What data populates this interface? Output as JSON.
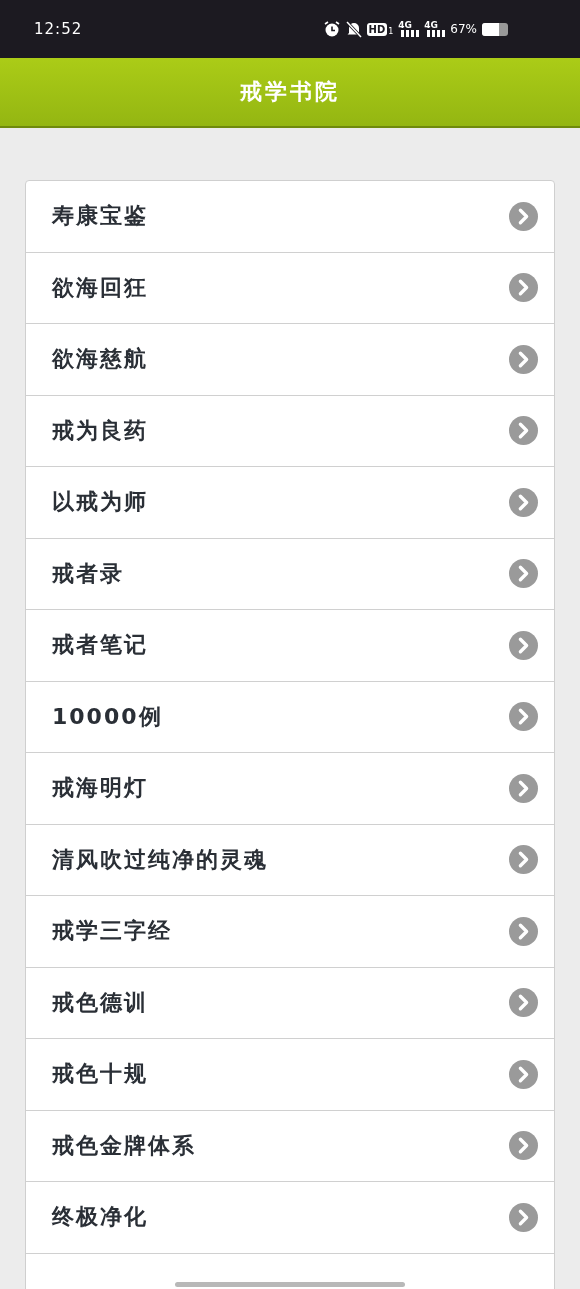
{
  "status_bar": {
    "time": "12:52",
    "hd_label": "HD",
    "hd_sim": "1",
    "network_1": "4G",
    "network_2": "4G",
    "battery_percent": "67%"
  },
  "header": {
    "title": "戒学书院"
  },
  "menu_items": [
    {
      "label": "寿康宝鉴"
    },
    {
      "label": "欲海回狂"
    },
    {
      "label": "欲海慈航"
    },
    {
      "label": "戒为良药"
    },
    {
      "label": "以戒为师"
    },
    {
      "label": "戒者录"
    },
    {
      "label": "戒者笔记"
    },
    {
      "label": "10000例"
    },
    {
      "label": "戒海明灯"
    },
    {
      "label": "清风吹过纯净的灵魂"
    },
    {
      "label": "戒学三字经"
    },
    {
      "label": "戒色德训"
    },
    {
      "label": "戒色十规"
    },
    {
      "label": "戒色金牌体系"
    },
    {
      "label": "终极净化"
    }
  ]
}
